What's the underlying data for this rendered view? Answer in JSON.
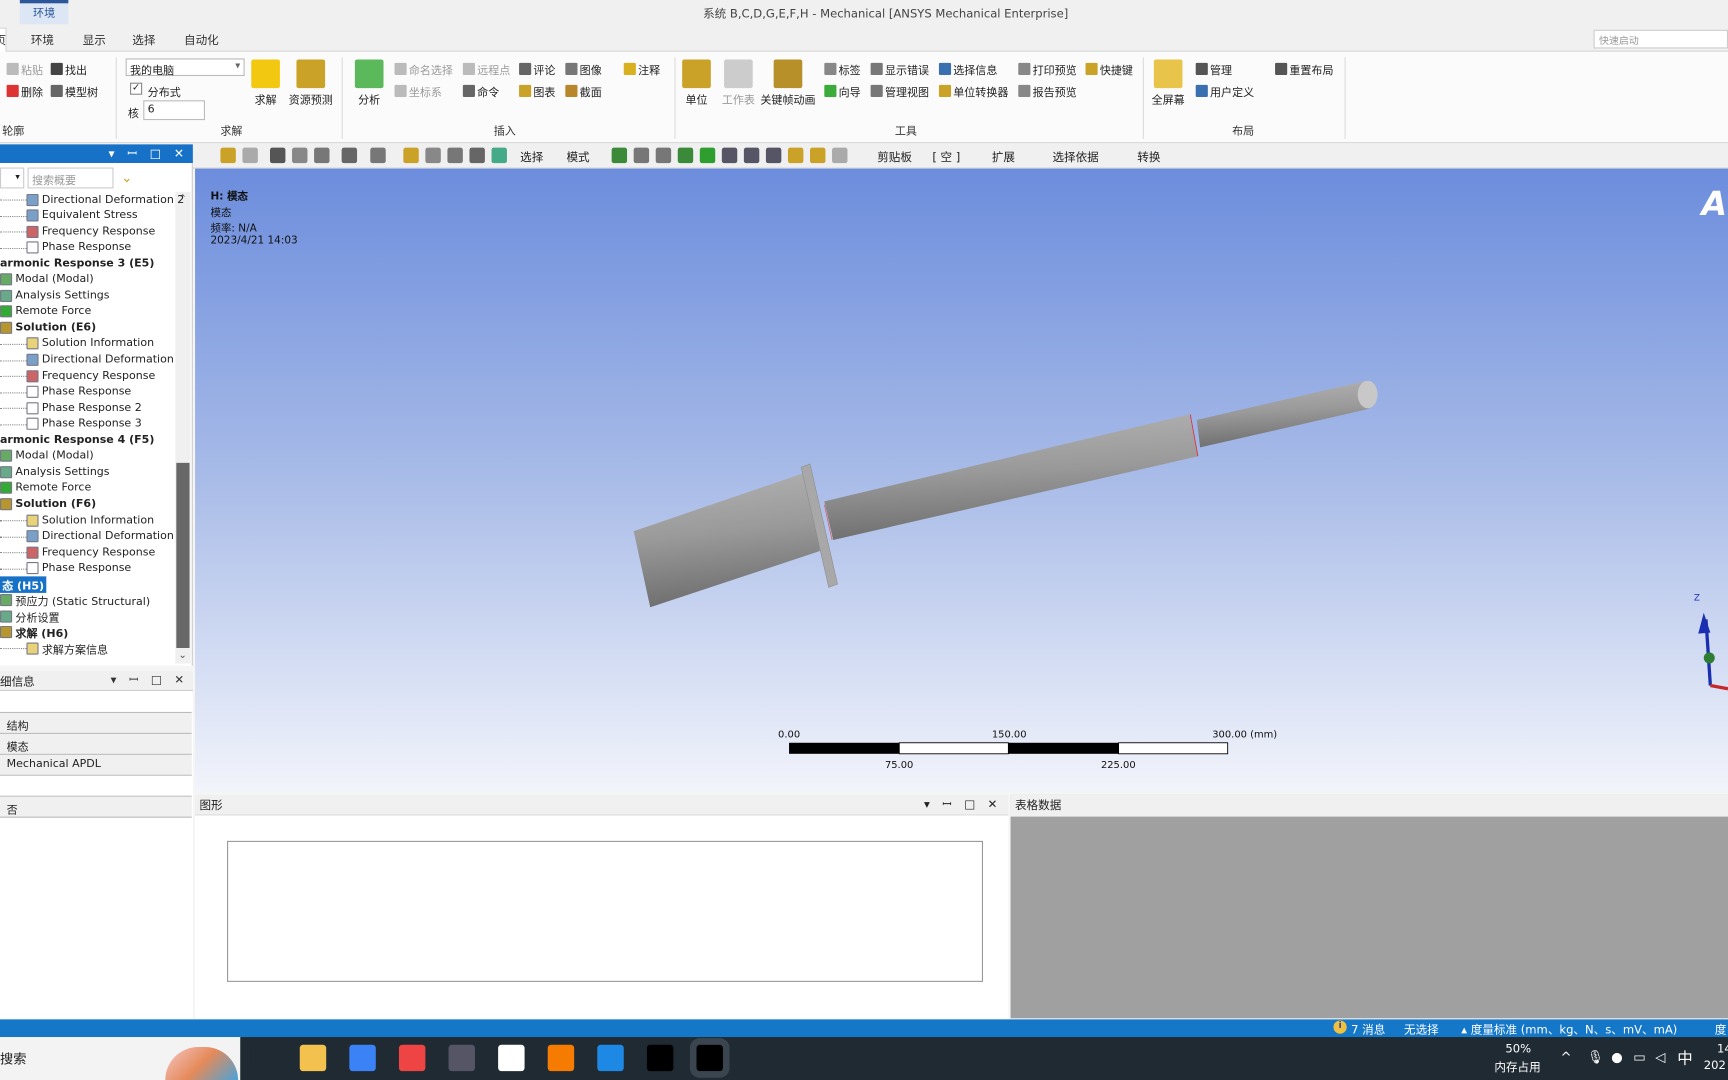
{
  "window": {
    "title": "系统 B,C,D,G,E,F,H - Mechanical [ANSYS Mechanical Enterprise]",
    "context_tab": "环境",
    "quick_launch_placeholder": "快速启动"
  },
  "ribbon": {
    "tabs": [
      {
        "label": "页",
        "active": true
      },
      {
        "label": "环境"
      },
      {
        "label": "显示"
      },
      {
        "label": "选择"
      },
      {
        "label": "自动化"
      }
    ],
    "groups": {
      "outline": "轮廓",
      "solve": "求解",
      "insert": "插入",
      "tools": "工具",
      "layout": "布局"
    },
    "outline": {
      "paste": "粘贴",
      "find": "找出",
      "delete": "删除",
      "tree": "模型树"
    },
    "solve": {
      "target": "我的电脑",
      "distributed": "分布式",
      "distributed_checked": true,
      "cores_label": "核",
      "cores": "6",
      "solve": "求解",
      "resource": "资源预测"
    },
    "insert": {
      "analysis": "分析",
      "named_sel": "命名选择",
      "remote_pt": "远程点",
      "comment": "评论",
      "image": "图像",
      "annotation": "注释",
      "coord": "坐标系",
      "command": "命令",
      "chart": "图表",
      "section": "截面"
    },
    "tools": {
      "units": "单位",
      "worksheet": "工作表",
      "keyframe": "关键帧动画",
      "tag": "标签",
      "show_err": "显示错误",
      "sel_info": "选择信息",
      "print": "打印预览",
      "shortcut": "快捷键",
      "wizard": "向导",
      "manage_view": "管理视图",
      "unit_conv": "单位转换器",
      "report": "报告预览"
    },
    "layout": {
      "fullscreen": "全屏幕",
      "manage": "管理",
      "user_def": "用户定义",
      "reset": "重置布局"
    }
  },
  "toolbar": {
    "select": "选择",
    "mode": "模式",
    "clipboard": "剪贴板",
    "empty": "[ 空 ]",
    "extend": "扩展",
    "select_by": "选择依据",
    "convert": "转换"
  },
  "tree": {
    "search_placeholder": "搜索概要",
    "items": [
      {
        "label": "Directional Deformation 2",
        "lvl": 2,
        "icon": "contour"
      },
      {
        "label": "Equivalent Stress",
        "lvl": 2,
        "icon": "contour"
      },
      {
        "label": "Frequency Response",
        "lvl": 2,
        "icon": "freq"
      },
      {
        "label": "Phase Response",
        "lvl": 2,
        "icon": "phase"
      },
      {
        "label": "armonic Response 3 (E5)",
        "lvl": 0,
        "bold": true
      },
      {
        "label": "Modal (Modal)",
        "lvl": 1,
        "icon": "modal"
      },
      {
        "label": "Analysis Settings",
        "lvl": 1,
        "icon": "settings"
      },
      {
        "label": "Remote Force",
        "lvl": 1,
        "icon": "force"
      },
      {
        "label": "Solution (E6)",
        "lvl": 1,
        "bold": true,
        "icon": "solution"
      },
      {
        "label": "Solution Information",
        "lvl": 2,
        "icon": "info"
      },
      {
        "label": "Directional Deformation",
        "lvl": 2,
        "icon": "contour"
      },
      {
        "label": "Frequency Response",
        "lvl": 2,
        "icon": "freq"
      },
      {
        "label": "Phase Response",
        "lvl": 2,
        "icon": "phase"
      },
      {
        "label": "Phase Response 2",
        "lvl": 2,
        "icon": "phase"
      },
      {
        "label": "Phase Response 3",
        "lvl": 2,
        "icon": "phase"
      },
      {
        "label": "armonic Response 4 (F5)",
        "lvl": 0,
        "bold": true
      },
      {
        "label": "Modal (Modal)",
        "lvl": 1,
        "icon": "modal"
      },
      {
        "label": "Analysis Settings",
        "lvl": 1,
        "icon": "settings"
      },
      {
        "label": "Remote Force",
        "lvl": 1,
        "icon": "force"
      },
      {
        "label": "Solution (F6)",
        "lvl": 1,
        "bold": true,
        "icon": "solution"
      },
      {
        "label": "Solution Information",
        "lvl": 2,
        "icon": "info"
      },
      {
        "label": "Directional Deformation",
        "lvl": 2,
        "icon": "contour"
      },
      {
        "label": "Frequency Response",
        "lvl": 2,
        "icon": "freq"
      },
      {
        "label": "Phase Response",
        "lvl": 2,
        "icon": "phase"
      },
      {
        "label": "态 (H5)",
        "lvl": 0,
        "bold": true,
        "selected": true
      },
      {
        "label": "预应力 (Static Structural)",
        "lvl": 1,
        "icon": "modal"
      },
      {
        "label": "分析设置",
        "lvl": 1,
        "icon": "settings"
      },
      {
        "label": "求解 (H6)",
        "lvl": 1,
        "bold": true,
        "icon": "solution"
      },
      {
        "label": "求解方案信息",
        "lvl": 2,
        "icon": "info"
      }
    ]
  },
  "details": {
    "title": "细信息",
    "rows": [
      "",
      "结构",
      "模态",
      "Mechanical APDL",
      "",
      "否"
    ]
  },
  "viewport": {
    "title": "H: 模态",
    "subtitle": "模态",
    "freq": "频率: N/A",
    "date": "2023/4/21 14:03",
    "logo": "A",
    "scale": {
      "l0": "0.00",
      "l150": "150.00",
      "l300": "300.00 (mm)",
      "l75": "75.00",
      "l225": "225.00"
    },
    "axis": "Z"
  },
  "graph_panel": {
    "title": "图形"
  },
  "table_panel": {
    "title": "表格数据"
  },
  "status": {
    "messages": "7 消息",
    "selection": "无选择",
    "units": "度量标准 (mm、kg、N、s、mV、mA)",
    "angle": "度"
  },
  "taskbar": {
    "search": "搜索",
    "mem_pct": "50%",
    "mem_label": "内存占用",
    "ime": "中",
    "time": "14",
    "date": "202"
  },
  "colors": {
    "accent": "#1772c7",
    "status": "#1477c8",
    "selected": "#1772c7"
  }
}
